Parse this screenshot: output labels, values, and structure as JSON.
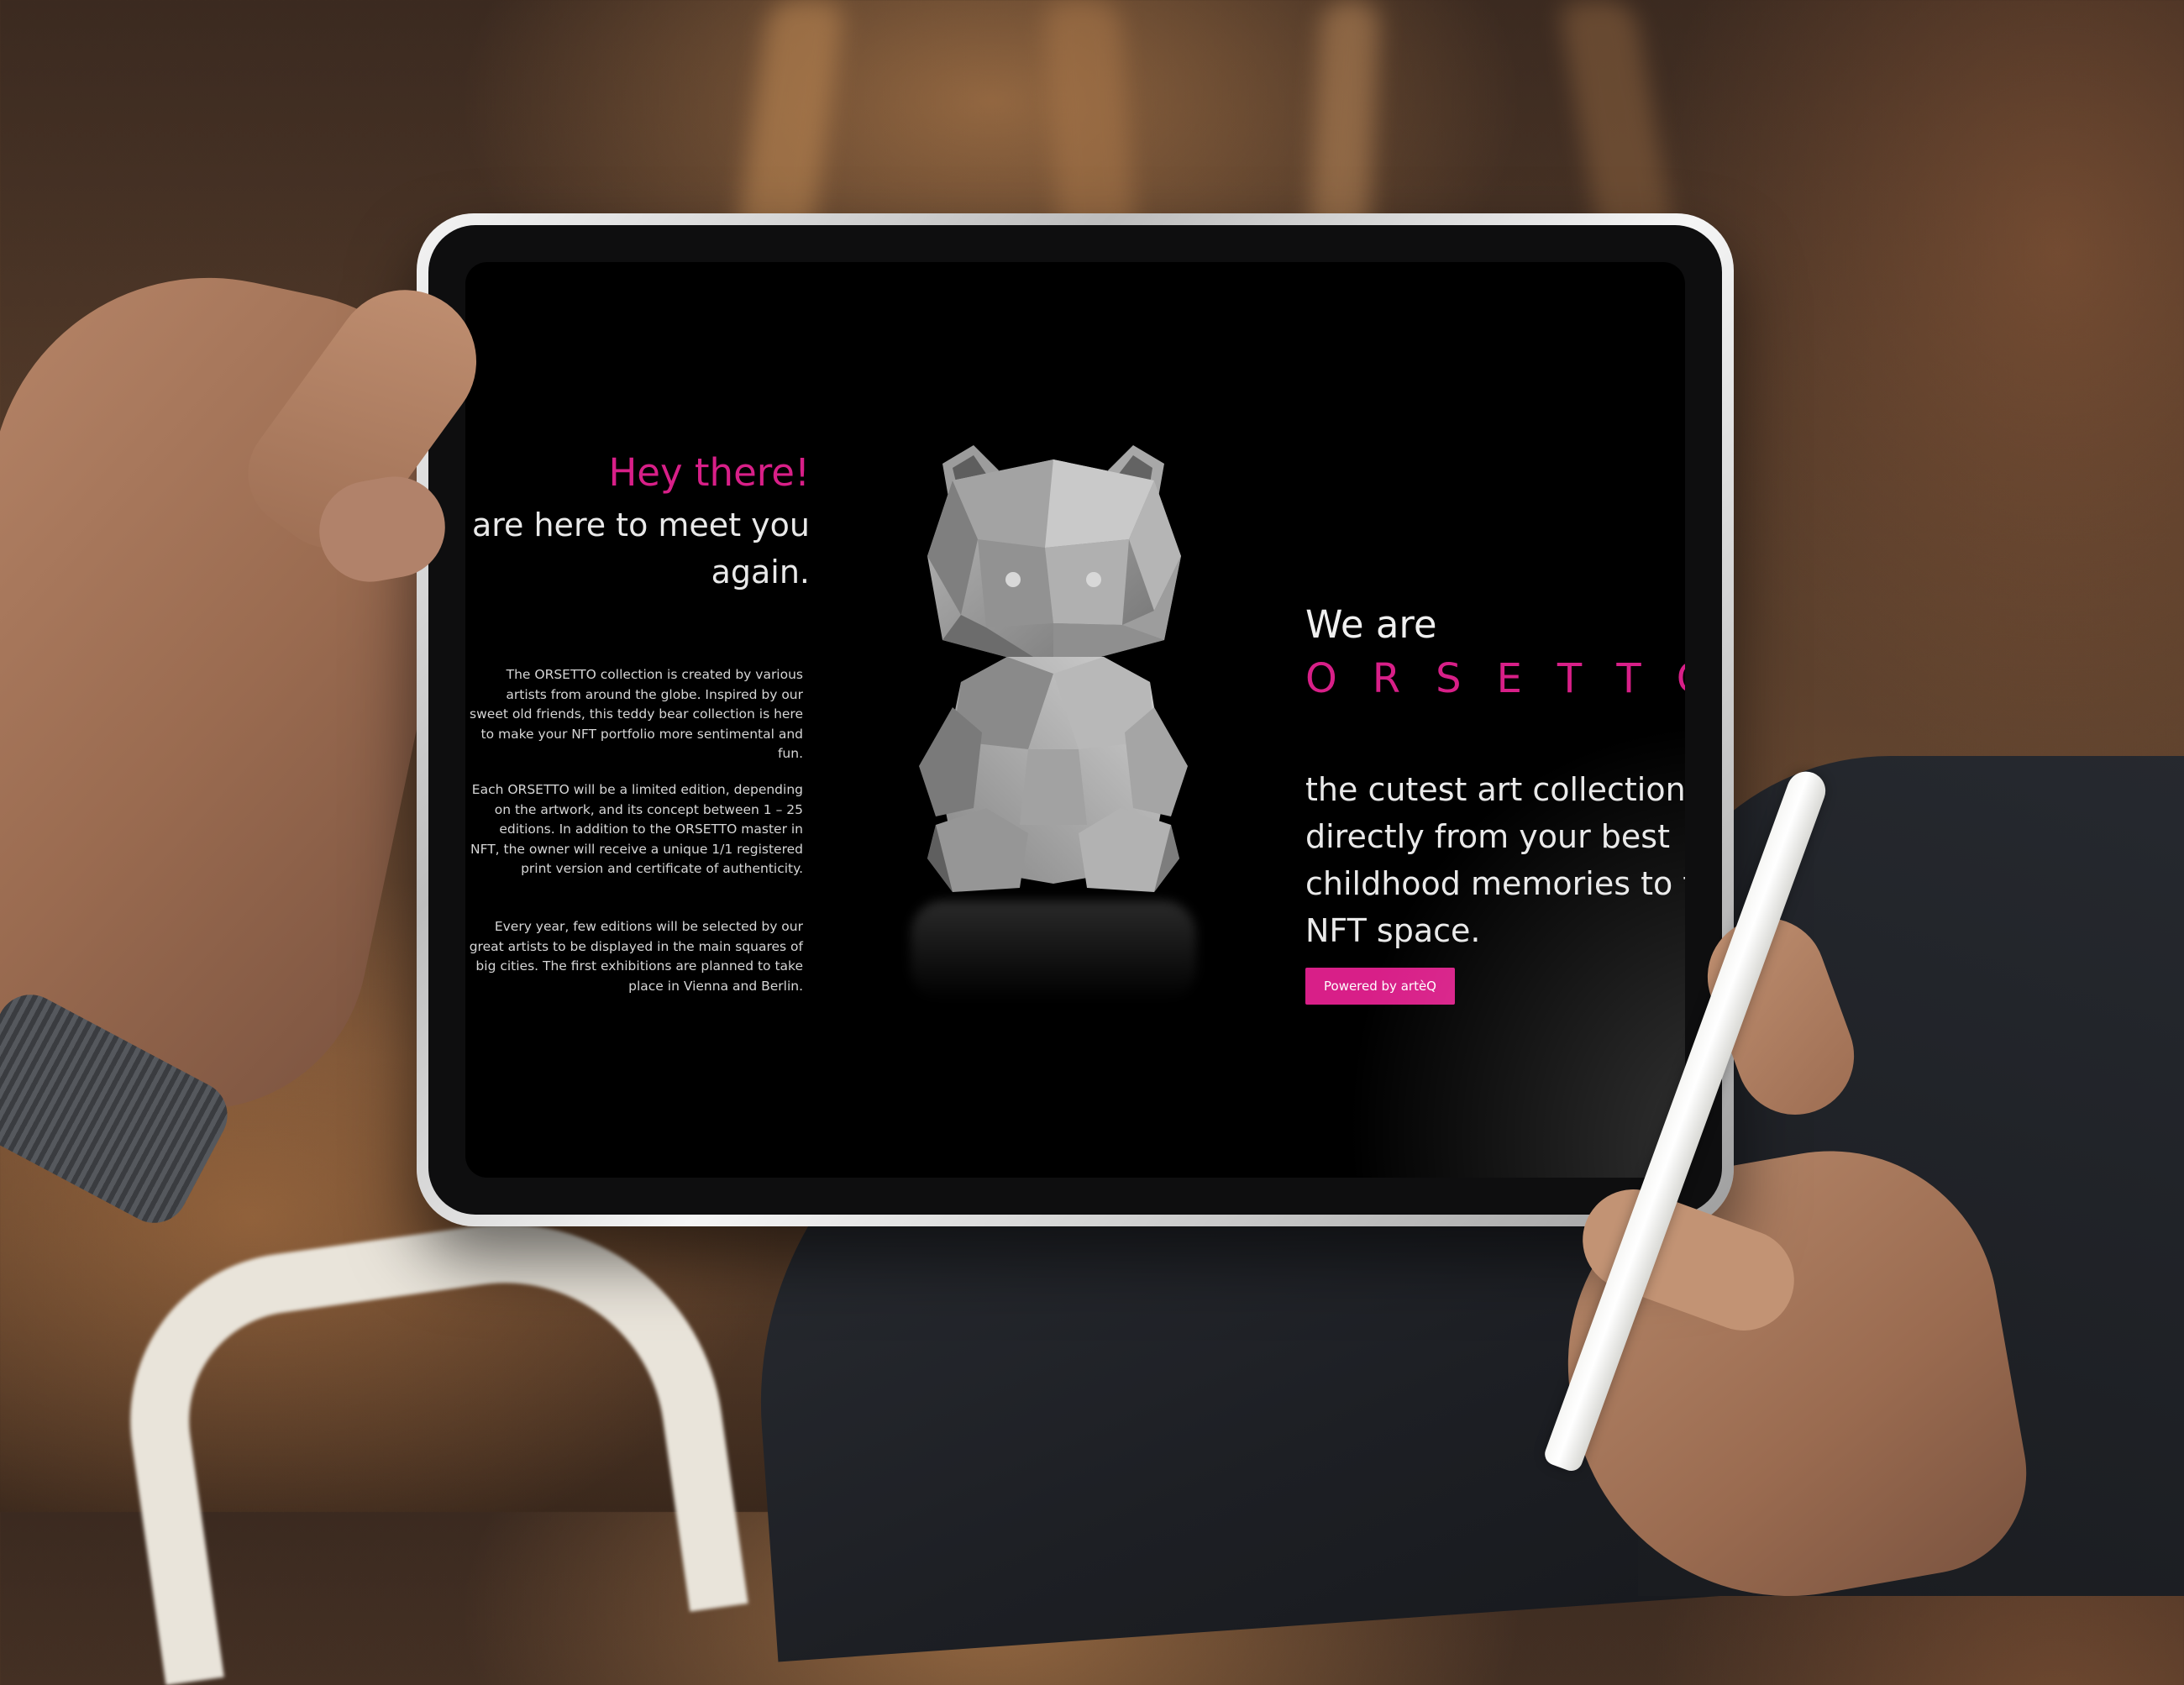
{
  "hero": {
    "greeting": "Hey there!",
    "subtitle": "We are here to meet you again."
  },
  "about": {
    "paragraphs": [
      "The ORSETTO collection is created by various artists from around the globe. Inspired by our sweet old friends, this teddy bear collection is here to make your NFT portfolio more sentimental and fun.",
      "Each ORSETTO will be a limited edition, depending on the artwork, and its concept between 1 – 25 editions. In addition to the ORSETTO master in NFT, the owner will receive a unique 1/1 registered print version and certificate of authenticity.",
      "Every year, few editions will be selected by our great artists to be displayed in the main squares of big cities. The first exhibitions are planned to take place in Vienna and Berlin."
    ]
  },
  "brand": {
    "intro": "We are",
    "name": "ORSETTO",
    "tagline": "the cutest art collection directly from your best childhood memories to the NFT space.",
    "powered_button": "Powered by artèQ"
  },
  "colors": {
    "accent": "#d81f88",
    "screen_bg": "#000000",
    "text": "#e9e9e9"
  },
  "icons": {
    "hero_image": "low-poly-teddy-bear-sculpture"
  }
}
